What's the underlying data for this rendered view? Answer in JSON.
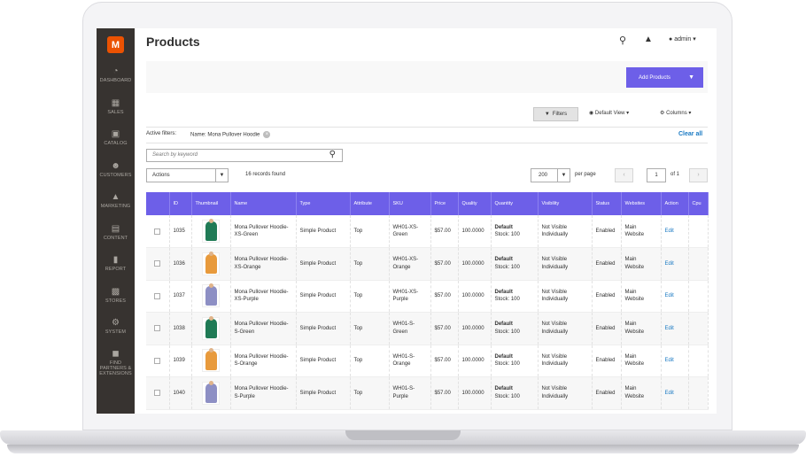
{
  "app": {
    "page_title": "Products",
    "user": "admin"
  },
  "sidebar": {
    "items": [
      {
        "label": "DASHBOARD",
        "icon": "dashboard-icon"
      },
      {
        "label": "SALES",
        "icon": "dollar-icon"
      },
      {
        "label": "CATALOG",
        "icon": "cube-icon"
      },
      {
        "label": "CUSTOMERS",
        "icon": "people-icon"
      },
      {
        "label": "MARKETING",
        "icon": "megaphone-icon"
      },
      {
        "label": "CONTENT",
        "icon": "content-icon"
      },
      {
        "label": "REPORT",
        "icon": "bar-chart-icon"
      },
      {
        "label": "STORES",
        "icon": "store-icon"
      },
      {
        "label": "SYSTEM",
        "icon": "gear-icon"
      },
      {
        "label": "FIND PARTNERS & EXTENSIONS",
        "icon": "puzzle-icon"
      }
    ]
  },
  "toolbar": {
    "add_label": "Add Products",
    "filters_label": "Filters",
    "view_label": "Default View",
    "columns_label": "Columns"
  },
  "filters": {
    "active_label": "Active filters:",
    "chip": "Name: Mona Pullover Hoodie",
    "clear_all": "Clear all"
  },
  "search": {
    "placeholder": "Search by keyword"
  },
  "grid_controls": {
    "actions_label": "Actions",
    "records": "16 records found",
    "per_page_value": "200",
    "per_page_label": "per page",
    "page_value": "1",
    "page_of": "of 1"
  },
  "table": {
    "columns": [
      "ID",
      "Thumbnail",
      "Name",
      "Type",
      "Attribute",
      "SKU",
      "Price",
      "Quality",
      "Quantity",
      "Visibility",
      "Status",
      "Websites",
      "Action",
      "Cpu"
    ],
    "rows": [
      {
        "id": "1035",
        "color": "#1f7a55",
        "name": "Mona Pullover Hoodie-XS-Green",
        "type": "Simple Product",
        "attribute": "Top",
        "sku": "WH01-XS-Green",
        "price": "$57.00",
        "quality": "100.0000",
        "qty_label": "Default",
        "qty_value": "Stock: 100",
        "visibility": "Not Visible Individually",
        "status": "Enabled",
        "websites": "Main Website",
        "action": "Edit"
      },
      {
        "id": "1036",
        "color": "#e89a3c",
        "name": "Mona Pullover Hoodie-XS-Orange",
        "type": "Simple Product",
        "attribute": "Top",
        "sku": "WH01-XS-Orange",
        "price": "$57.00",
        "quality": "100.0000",
        "qty_label": "Default",
        "qty_value": "Stock: 100",
        "visibility": "Not Visible Individually",
        "status": "Enabled",
        "websites": "Main Website",
        "action": "Edit"
      },
      {
        "id": "1037",
        "color": "#8d8fc4",
        "name": "Mona Pullover Hoodie-XS-Purple",
        "type": "Simple Product",
        "attribute": "Top",
        "sku": "WH01-XS-Purple",
        "price": "$57.00",
        "quality": "100.0000",
        "qty_label": "Default",
        "qty_value": "Stock: 100",
        "visibility": "Not Visible Individually",
        "status": "Enabled",
        "websites": "Main Website",
        "action": "Edit"
      },
      {
        "id": "1038",
        "color": "#1f7a55",
        "name": "Mona Pullover Hoodie-S-Green",
        "type": "Simple Product",
        "attribute": "Top",
        "sku": "WH01-S-Green",
        "price": "$57.00",
        "quality": "100.0000",
        "qty_label": "Default",
        "qty_value": "Stock: 100",
        "visibility": "Not Visible Individually",
        "status": "Enabled",
        "websites": "Main Website",
        "action": "Edit"
      },
      {
        "id": "1039",
        "color": "#e89a3c",
        "name": "Mona Pullover Hoodie-S-Orange",
        "type": "Simple Product",
        "attribute": "Top",
        "sku": "WH01-S-Orange",
        "price": "$57.00",
        "quality": "100.0000",
        "qty_label": "Default",
        "qty_value": "Stock: 100",
        "visibility": "Not Visible Individually",
        "status": "Enabled",
        "websites": "Main Website",
        "action": "Edit"
      },
      {
        "id": "1040",
        "color": "#8d8fc4",
        "name": "Mona Pullover Hoodie-S-Purple",
        "type": "Simple Product",
        "attribute": "Top",
        "sku": "WH01-S-Purple",
        "price": "$57.00",
        "quality": "100.0000",
        "qty_label": "Default",
        "qty_value": "Stock: 100",
        "visibility": "Not Visible Individually",
        "status": "Enabled",
        "websites": "Main Website",
        "action": "Edit"
      }
    ]
  },
  "colors": {
    "accent": "#6d5fe8",
    "sidebar": "#373330",
    "logo": "#eb5202",
    "link": "#1979c3"
  }
}
